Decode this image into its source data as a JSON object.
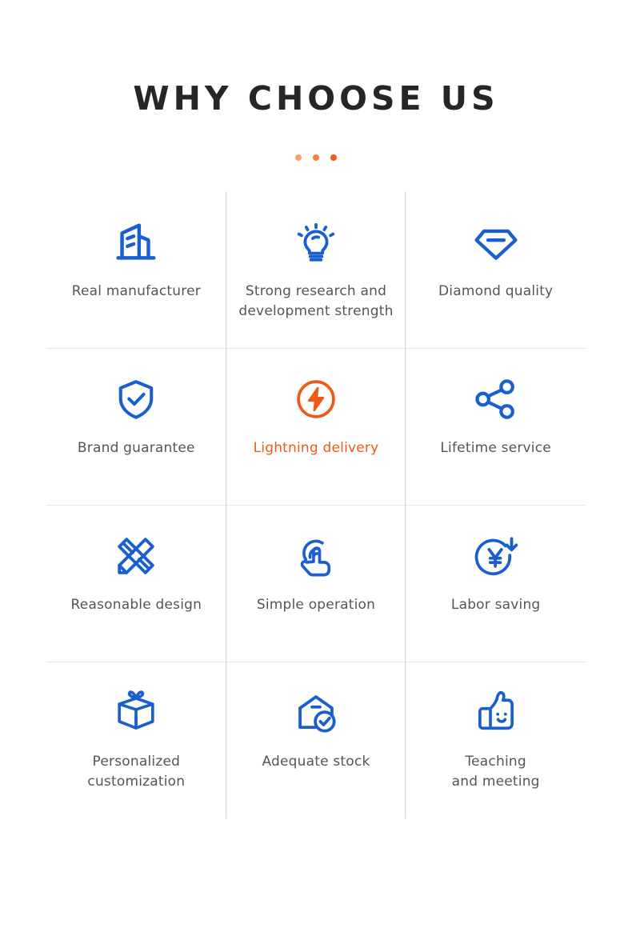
{
  "header": {
    "title": "WHY CHOOSE US",
    "dots": [
      "dot-light",
      "dot-medium",
      "dot-dark"
    ]
  },
  "colors": {
    "brand_blue": "#1a5fd0",
    "accent_orange": "#ef5a18",
    "title_text": "#262626",
    "label_text": "#555555",
    "divider": "#e0e0e0",
    "background": "#ffffff"
  },
  "grid": {
    "columns": 3,
    "rows": 4,
    "items": [
      {
        "id": "real-manufacturer",
        "icon": "factory-building-icon",
        "label": "Real manufacturer",
        "color": "blue"
      },
      {
        "id": "strong-research",
        "icon": "lightbulb-icon",
        "label": "Strong research and\ndevelopment strength",
        "color": "blue"
      },
      {
        "id": "diamond-quality",
        "icon": "diamond-icon",
        "label": "Diamond quality",
        "color": "blue"
      },
      {
        "id": "brand-guarantee",
        "icon": "shield-check-icon",
        "label": "Brand guarantee",
        "color": "blue"
      },
      {
        "id": "lightning-delivery",
        "icon": "lightning-circle-icon",
        "label": "Lightning delivery",
        "color": "orange"
      },
      {
        "id": "lifetime-service",
        "icon": "share-network-icon",
        "label": "Lifetime service",
        "color": "blue"
      },
      {
        "id": "reasonable-design",
        "icon": "pencil-ruler-icon",
        "label": "Reasonable design",
        "color": "blue"
      },
      {
        "id": "simple-operation",
        "icon": "touch-hand-icon",
        "label": "Simple operation",
        "color": "blue"
      },
      {
        "id": "labor-saving",
        "icon": "yuan-down-arrow-icon",
        "label": "Labor saving",
        "color": "blue"
      },
      {
        "id": "personalized-customization",
        "icon": "gift-box-icon",
        "label": "Personalized\ncustomization",
        "color": "blue"
      },
      {
        "id": "adequate-stock",
        "icon": "warehouse-check-icon",
        "label": "Adequate stock",
        "color": "blue"
      },
      {
        "id": "teaching-and-meeting",
        "icon": "thumbs-up-smile-icon",
        "label": "Teaching\nand meeting",
        "color": "blue"
      }
    ]
  }
}
